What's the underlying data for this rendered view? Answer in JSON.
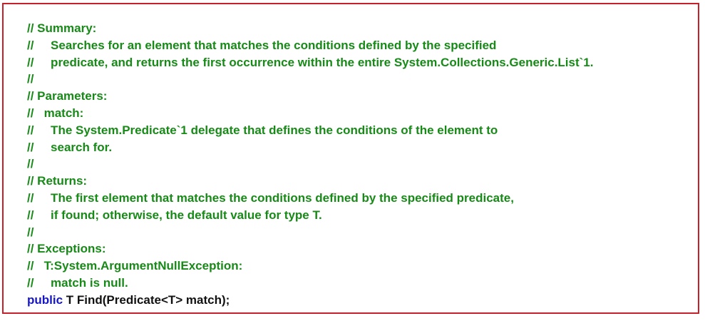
{
  "colors": {
    "border": "#c8202a",
    "comment": "#178a17",
    "keyword": "#1616c8",
    "text": "#111111"
  },
  "comment_lines": [
    "// Summary:",
    "//     Searches for an element that matches the conditions defined by the specified",
    "//     predicate, and returns the first occurrence within the entire System.Collections.Generic.List`1.",
    "//",
    "// Parameters:",
    "//   match:",
    "//     The System.Predicate`1 delegate that defines the conditions of the element to",
    "//     search for.",
    "//",
    "// Returns:",
    "//     The first element that matches the conditions defined by the specified predicate,",
    "//     if found; otherwise, the default value for type T.",
    "//",
    "// Exceptions:",
    "//   T:System.ArgumentNullException:",
    "//     match is null."
  ],
  "signature": {
    "keyword": "public",
    "rest": " T Find(Predicate<T> match);"
  }
}
